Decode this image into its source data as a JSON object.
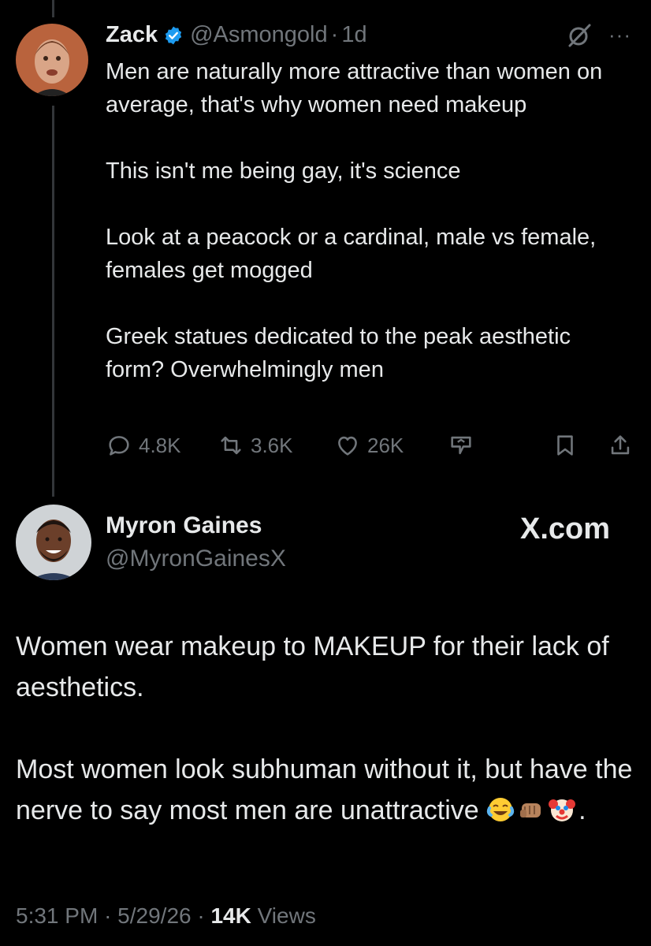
{
  "quoted_tweet": {
    "author_name": "Zack",
    "handle": "@Asmongold",
    "separator": "·",
    "time_ago": "1d",
    "verified": true,
    "paragraphs": [
      "Men are naturally more attractive than women on average, that's why women need makeup",
      "This isn't me being gay, it's science",
      "Look at a peacock or a cardinal, male vs female, females get mogged",
      "Greek statues dedicated to the peak aesthetic form? Overwhelmingly men"
    ],
    "stats": {
      "replies": "4.8K",
      "reposts": "3.6K",
      "likes": "26K"
    },
    "icons": [
      "grok-icon",
      "more-icon",
      "reply-icon",
      "repost-icon",
      "like-icon",
      "grok-analyze-icon",
      "bookmark-icon",
      "share-icon"
    ]
  },
  "reply_tweet": {
    "author_name": "Myron Gaines",
    "handle": "@MyronGainesX",
    "brand": "X.com",
    "paragraphs": [
      "Women wear makeup to MAKEUP for their lack of aesthetics.",
      "Most women look subhuman without it, but have the nerve to say most men are unattractive"
    ],
    "trailing": ".",
    "emojis": [
      "tears-of-joy-emoji",
      "fist-bump-emoji",
      "clown-face-emoji"
    ],
    "footer": {
      "time": "5:31 PM",
      "sep": "·",
      "date": "5/29/26",
      "views_count": "14K",
      "views_label": "Views"
    }
  },
  "colors": {
    "background": "#000000",
    "text": "#e7e9ea",
    "muted": "#71767b",
    "verified": "#1d9bf0"
  }
}
